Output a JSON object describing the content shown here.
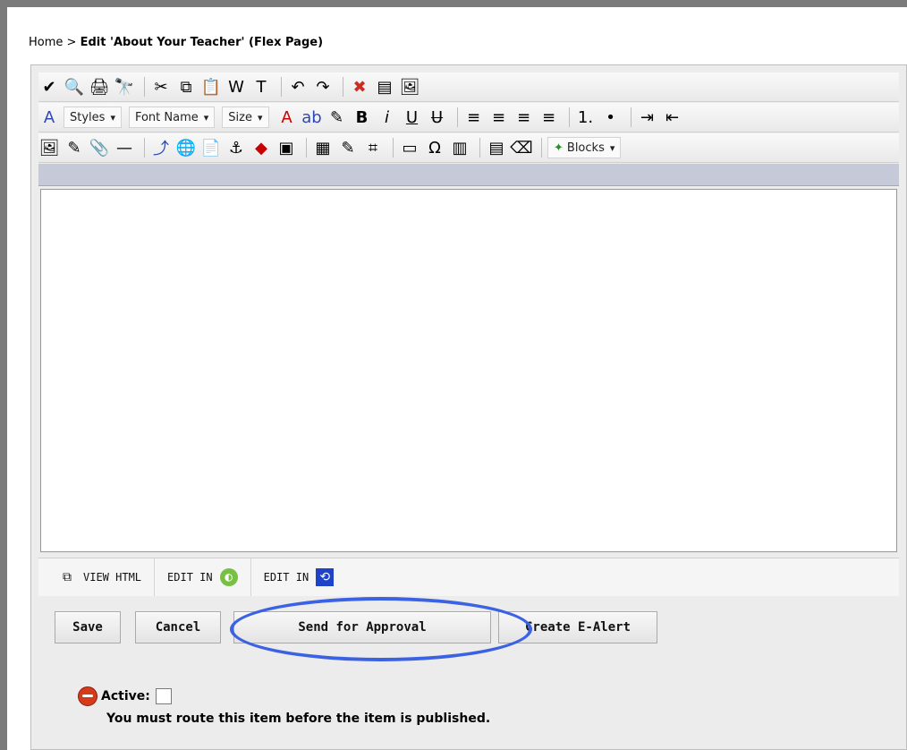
{
  "breadcrumb": {
    "home": "Home",
    "sep": ">",
    "title": "Edit 'About Your Teacher' (Flex Page)"
  },
  "toolbar": {
    "row1": [
      "spellcheck-icon",
      "find-icon",
      "print-icon",
      "binoculars-icon",
      "cut-icon",
      "copy-icon",
      "paste-icon",
      "paste-word-icon",
      "paste-text-icon",
      "undo-icon",
      "redo-icon",
      "remove-format-icon",
      "preview-icon",
      "presentation-icon"
    ],
    "row2": {
      "styles_label": "Styles",
      "font_label": "Font Name",
      "size_label": "Size",
      "icons": [
        "font-color-icon",
        "highlight-icon",
        "format-painter-icon",
        "bold-icon",
        "italic-icon",
        "underline-icon",
        "strikethrough-icon",
        "align-left-icon",
        "align-center-icon",
        "align-right-icon",
        "justify-icon",
        "numbered-list-icon",
        "bulleted-list-icon",
        "indent-icon",
        "outdent-icon"
      ]
    },
    "row3": {
      "icons": [
        "image-icon",
        "edit-image-icon",
        "attach-icon",
        "horizontal-rule-icon",
        "link-icon",
        "web-link-icon",
        "doc-link-icon",
        "anchor-icon",
        "flash-icon",
        "media-icon",
        "table-icon",
        "table-edit-icon",
        "table-grid-icon",
        "form-icon",
        "omega-icon",
        "chart-icon",
        "template-icon",
        "eraser-icon"
      ],
      "blocks_label": "Blocks"
    }
  },
  "modes": {
    "view_html": "VIEW HTML",
    "edit_in_1": "EDIT IN",
    "edit_in_2": "EDIT IN"
  },
  "buttons": {
    "save": "Save",
    "cancel": "Cancel",
    "send": "Send for Approval",
    "ealert": "Create E-Alert"
  },
  "status": {
    "active_label": "Active:",
    "message": "You must route this item before the item is published."
  },
  "colors": {
    "accent_blue": "#3b62e3",
    "badge_red": "#d53a1b"
  }
}
